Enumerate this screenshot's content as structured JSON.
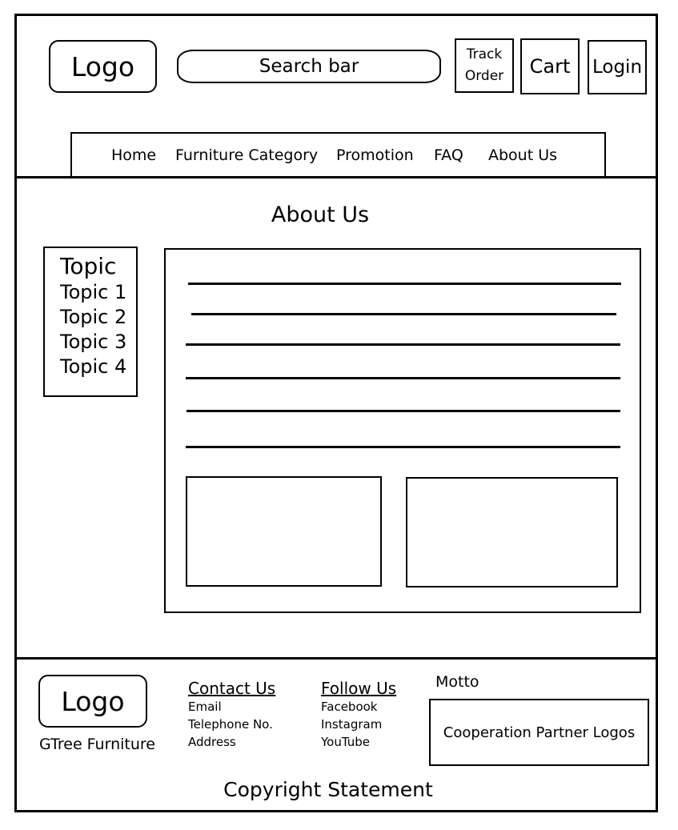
{
  "header": {
    "logo": "Logo",
    "search_placeholder": "Search bar",
    "track_order": [
      "Track",
      "Order"
    ],
    "cart": "Cart",
    "login": "Login"
  },
  "nav": {
    "items": [
      "Home",
      "Furniture Category",
      "Promotion",
      "FAQ",
      "About Us"
    ]
  },
  "main": {
    "title": "About Us",
    "topics": {
      "heading": "Topic",
      "items": [
        "Topic 1",
        "Topic 2",
        "Topic 3",
        "Topic 4"
      ]
    }
  },
  "footer": {
    "logo": "Logo",
    "brand": "GTree Furniture",
    "contact": {
      "title": "Contact Us",
      "items": [
        "Email",
        "Telephone No.",
        "Address"
      ]
    },
    "follow": {
      "title": "Follow Us",
      "items": [
        "Facebook",
        "Instagram",
        "YouTube"
      ]
    },
    "motto": "Motto",
    "partners": "Cooperation Partner Logos",
    "copyright": "Copyright Statement"
  }
}
